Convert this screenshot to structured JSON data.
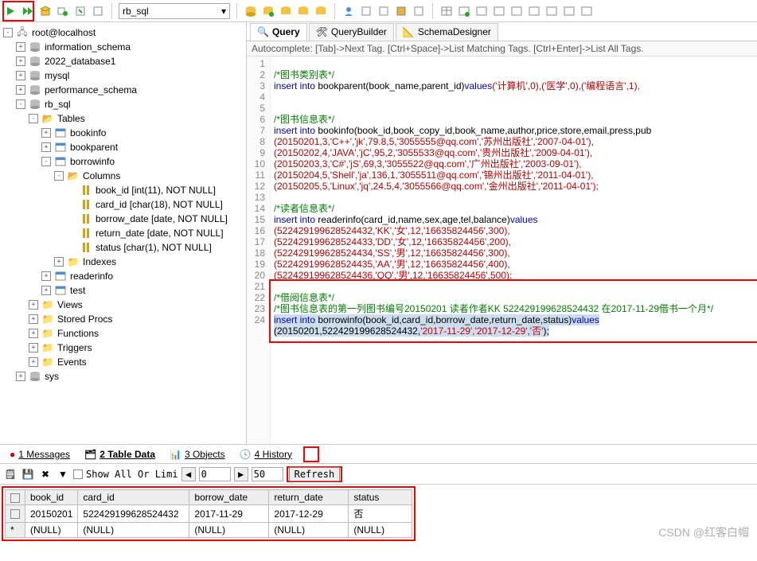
{
  "toolbar": {
    "db_dropdown": "rb_sql"
  },
  "tree": {
    "root": "root@localhost",
    "dbs": [
      "information_schema",
      "2022_database1",
      "mysql",
      "performance_schema"
    ],
    "rb_sql": "rb_sql",
    "tables_label": "Tables",
    "tables": [
      "bookinfo",
      "bookparent"
    ],
    "borrowinfo": "borrowinfo",
    "columns_label": "Columns",
    "columns": [
      "book_id [int(11), NOT NULL]",
      "card_id [char(18), NOT NULL]",
      "borrow_date [date, NOT NULL]",
      "return_date [date, NOT NULL]",
      "status [char(1), NOT NULL]"
    ],
    "indexes": "Indexes",
    "other_tables": [
      "readerinfo",
      "test"
    ],
    "folders": [
      "Views",
      "Stored Procs",
      "Functions",
      "Triggers",
      "Events"
    ],
    "sys": "sys"
  },
  "tabs": {
    "query": "Query",
    "qb": "QueryBuilder",
    "sd": "SchemaDesigner"
  },
  "hint": "Autocomplete: [Tab]->Next Tag. [Ctrl+Space]->List Matching Tags. [Ctrl+Enter]->List All Tags.",
  "code": {
    "l1": "/*图书类别表*/",
    "l2a": "insert into",
    "l2b": " bookparent(book_name,parent_id)",
    "l2c": "values",
    "l2d": "('计算机',0),('医学',0),('编程语言',1),",
    "l5": "/*图书信息表*/",
    "l6a": "insert into",
    "l6b": " bookinfo(book_id,book_copy_id,book_name,author,price,store,email,press,pub",
    "l7": "(20150201,3,'C++','jk',79.8,5,'3055555@qq.com','苏州出版社','2007-04-01'),",
    "l8": "(20150202,4,'JAVA','jC',95,2,'3055533@qq.com','贵州出版社','2009-04-01'),",
    "l9": "(20150203,3,'C#','jS',69,3,'3055522@qq.com','广州出版社','2003-09-01'),",
    "l10": "(20150204,5,'Shell','ja',136,1,'3055511@qq.com','锦州出版社','2011-04-01'),",
    "l11": "(20150205,5,'Linux','jq',24.5,4,'3055566@qq.com','金州出版社','2011-04-01');",
    "l13": "/*读者信息表*/",
    "l14a": "insert into",
    "l14b": " readerinfo(card_id,name,sex,age,tel,balance)",
    "l14c": "values",
    "l15": "(522429199628524432,'KK','女',12,'16635824456',300),",
    "l16": "(522429199628524433,'DD','女',12,'16635824456',200),",
    "l17": "(522429199628524434,'SS','男',12,'16635824456',300),",
    "l18": "(522429199628524435,'AA','男',12,'16635824456',400),",
    "l19": "(522429199628524436,'QQ','男',12,'16635824456',500);",
    "l21": "/*借阅信息表*/",
    "l22": "/*图书信息表的第一列图书编号20150201 读者作者KK 522429199628524432 在2017-11-29借书一个月*/",
    "l23a": "insert into",
    "l23b": " borrowinfo(book_id,card_id,borrow_date,return_date,status)",
    "l23c": "values",
    "l24a": "(20150201,522429199628524432,",
    "l24b": "'2017-11-29','2017-12-29','否'",
    "l24c": ");"
  },
  "btabs": {
    "messages": "1 Messages",
    "tabledata": "2 Table Data",
    "objects": "3 Objects",
    "history": "4 History"
  },
  "btoolbar": {
    "showall": "Show All Or  Limi",
    "from": "0",
    "to": "50",
    "refresh": "Refresh"
  },
  "grid": {
    "headers": [
      "book_id",
      "card_id",
      "borrow_date",
      "return_date",
      "status"
    ],
    "row1": [
      "20150201",
      "522429199628524432",
      "2017-11-29",
      "2017-12-29",
      "否"
    ],
    "row2": [
      "(NULL)",
      "(NULL)",
      "(NULL)",
      "(NULL)",
      "(NULL)"
    ]
  },
  "watermark": "CSDN @红客白帽"
}
